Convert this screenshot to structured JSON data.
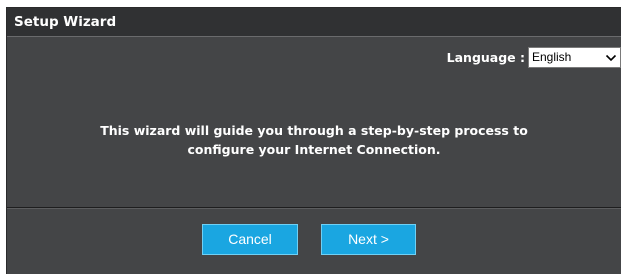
{
  "window": {
    "title": "Setup Wizard"
  },
  "language": {
    "label": "Language :",
    "selected": "English",
    "icon": "chevron-down-icon"
  },
  "message": {
    "line1": "This wizard will guide you through a step-by-step process to",
    "line2": "configure your Internet Connection."
  },
  "buttons": {
    "cancel_label": "Cancel",
    "next_label": "Next >"
  },
  "colors": {
    "panel_background": "#444547",
    "title_bar_background": "#303133",
    "button_background": "#1aa6e1",
    "text": "#ffffff"
  }
}
